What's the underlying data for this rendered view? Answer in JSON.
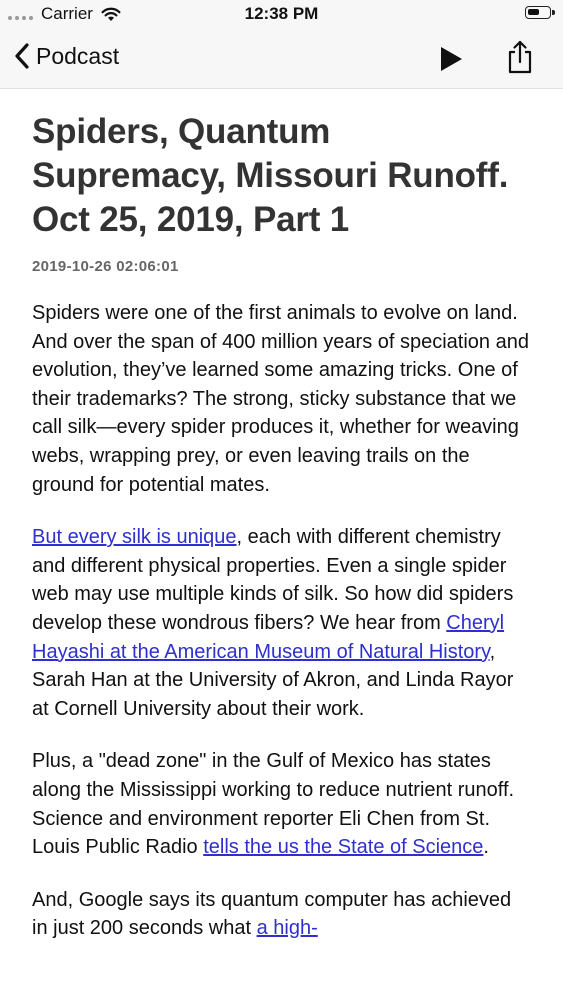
{
  "status_bar": {
    "carrier": "Carrier",
    "time": "12:38 PM"
  },
  "nav": {
    "back_label": "Podcast",
    "icons": [
      "chevron-left-icon",
      "play-icon",
      "share-icon"
    ]
  },
  "episode": {
    "title": "Spiders, Quantum Supremacy, Missouri Runoff. Oct 25, 2019, Part 1",
    "date": "2019-10-26 02:06:01",
    "p1": "Spiders were one of the first animals to evolve on land. And over the span of 400 million years of speciation and evolution, they’ve learned some amazing tricks. One of their trademarks? The strong, sticky substance that we call silk—every spider produces it, whether for weaving webs, wrapping prey, or even leaving trails on the ground for potential mates.",
    "p2_link1": "But every silk is unique",
    "p2_text1": ", each with different chemistry and different physical properties. Even a single spider web may use multiple kinds of silk. So how did spiders develop these wondrous fibers? We hear from ",
    "p2_link2": "Cheryl Hayashi at the American Museum of Natural History",
    "p2_text2": ", Sarah Han at the University of Akron, and Linda Rayor at Cornell University about their work.",
    "p3_text1": "Plus, a \"dead zone\" in the Gulf of Mexico has states along the Mississippi working to reduce nutrient runoff. Science and environment reporter Eli Chen from St. Louis Public Radio ",
    "p3_link": "tells the us the State of Science",
    "p3_text2": ".",
    "p4_text1": "And, Google says its quantum computer has achieved in just 200 seconds what ",
    "p4_link": "a high-"
  },
  "colors": {
    "link": "#2f2fcf",
    "bar_background": "#f7f7f7"
  }
}
